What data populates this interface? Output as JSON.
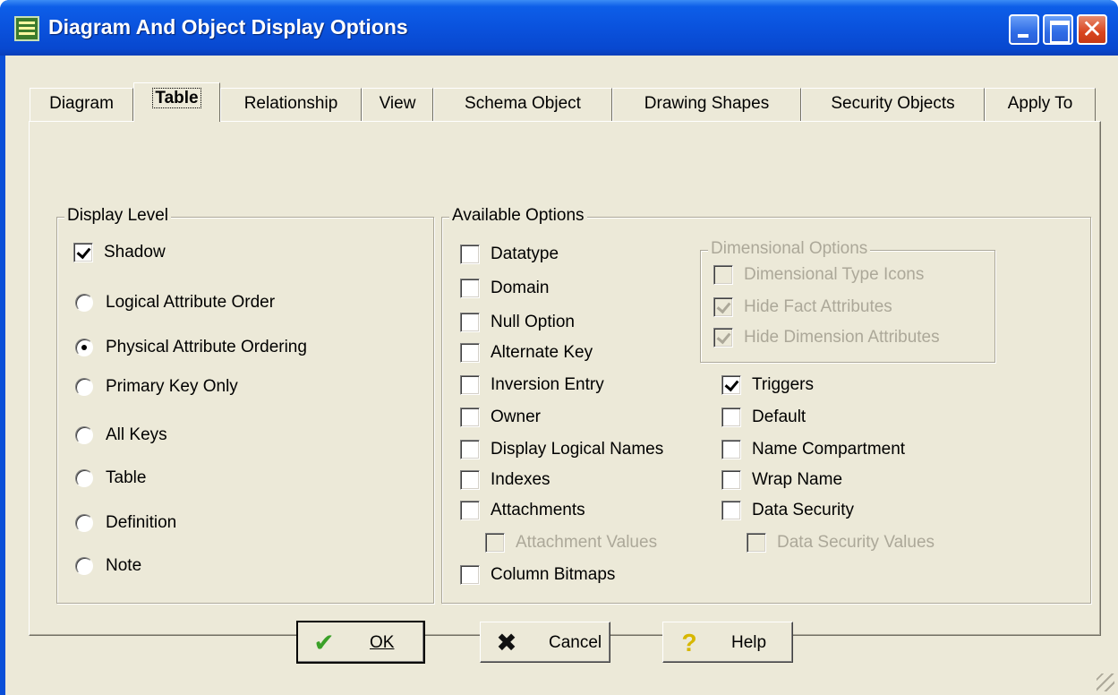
{
  "window": {
    "title": "Diagram And Object Display Options",
    "controls": [
      "minimize",
      "maximize",
      "close"
    ]
  },
  "tabs": [
    {
      "label": "Diagram",
      "active": false
    },
    {
      "label": "Table",
      "active": true
    },
    {
      "label": "Relationship",
      "active": false
    },
    {
      "label": "View",
      "active": false
    },
    {
      "label": "Schema Object",
      "active": false
    },
    {
      "label": "Drawing Shapes",
      "active": false
    },
    {
      "label": "Security Objects",
      "active": false
    },
    {
      "label": "Apply To",
      "active": false
    }
  ],
  "display_level": {
    "legend": "Display Level",
    "shadow": {
      "label": "Shadow",
      "checked": true
    },
    "options": [
      {
        "label": "Logical Attribute Order",
        "selected": false
      },
      {
        "label": "Physical Attribute Ordering",
        "selected": true
      },
      {
        "label": "Primary Key Only",
        "selected": false
      },
      {
        "label": "All Keys",
        "selected": false
      },
      {
        "label": "Table",
        "selected": false
      },
      {
        "label": "Definition",
        "selected": false
      },
      {
        "label": "Note",
        "selected": false
      }
    ]
  },
  "available_options": {
    "legend": "Available Options",
    "left": [
      {
        "label": "Datatype",
        "checked": false
      },
      {
        "label": "Domain",
        "checked": false
      },
      {
        "label": "Null Option",
        "checked": false
      },
      {
        "label": "Alternate Key",
        "checked": false
      },
      {
        "label": "Inversion Entry",
        "checked": false
      },
      {
        "label": "Owner",
        "checked": false
      },
      {
        "label": "Display Logical Names",
        "checked": false
      },
      {
        "label": "Indexes",
        "checked": false
      },
      {
        "label": "Attachments",
        "checked": false
      },
      {
        "label": "Attachment Values",
        "checked": false,
        "disabled": true
      },
      {
        "label": "Column Bitmaps",
        "checked": false
      }
    ],
    "dimensional": {
      "legend": "Dimensional Options",
      "items": [
        {
          "label": "Dimensional Type Icons",
          "checked": false,
          "disabled": true
        },
        {
          "label": "Hide Fact Attributes",
          "checked": true,
          "disabled": true
        },
        {
          "label": "Hide Dimension Attributes",
          "checked": true,
          "disabled": true
        }
      ]
    },
    "right": [
      {
        "label": "Triggers",
        "checked": true
      },
      {
        "label": "Default",
        "checked": false
      },
      {
        "label": "Name Compartment",
        "checked": false
      },
      {
        "label": "Wrap Name",
        "checked": false
      },
      {
        "label": "Data Security",
        "checked": false
      },
      {
        "label": "Data Security Values",
        "checked": false,
        "disabled": true
      }
    ]
  },
  "buttons": {
    "ok": {
      "label": "OK",
      "icon": "check-icon"
    },
    "cancel": {
      "label": "Cancel",
      "icon": "x-icon"
    },
    "help": {
      "label": "Help",
      "icon": "question-icon"
    }
  }
}
